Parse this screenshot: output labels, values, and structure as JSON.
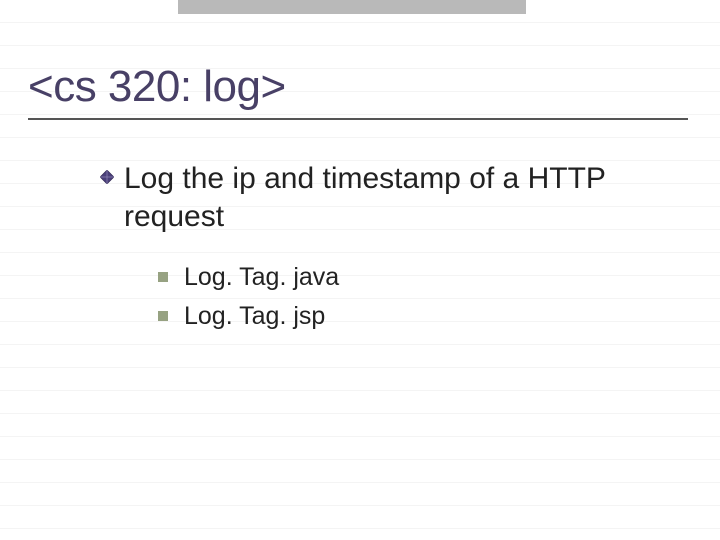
{
  "title": "<cs 320: log>",
  "bullets": {
    "level1": [
      {
        "text": "Log the ip and timestamp of a HTTP request"
      }
    ],
    "level2": [
      {
        "text": "Log. Tag. java"
      },
      {
        "text": "Log. Tag. jsp"
      }
    ]
  }
}
